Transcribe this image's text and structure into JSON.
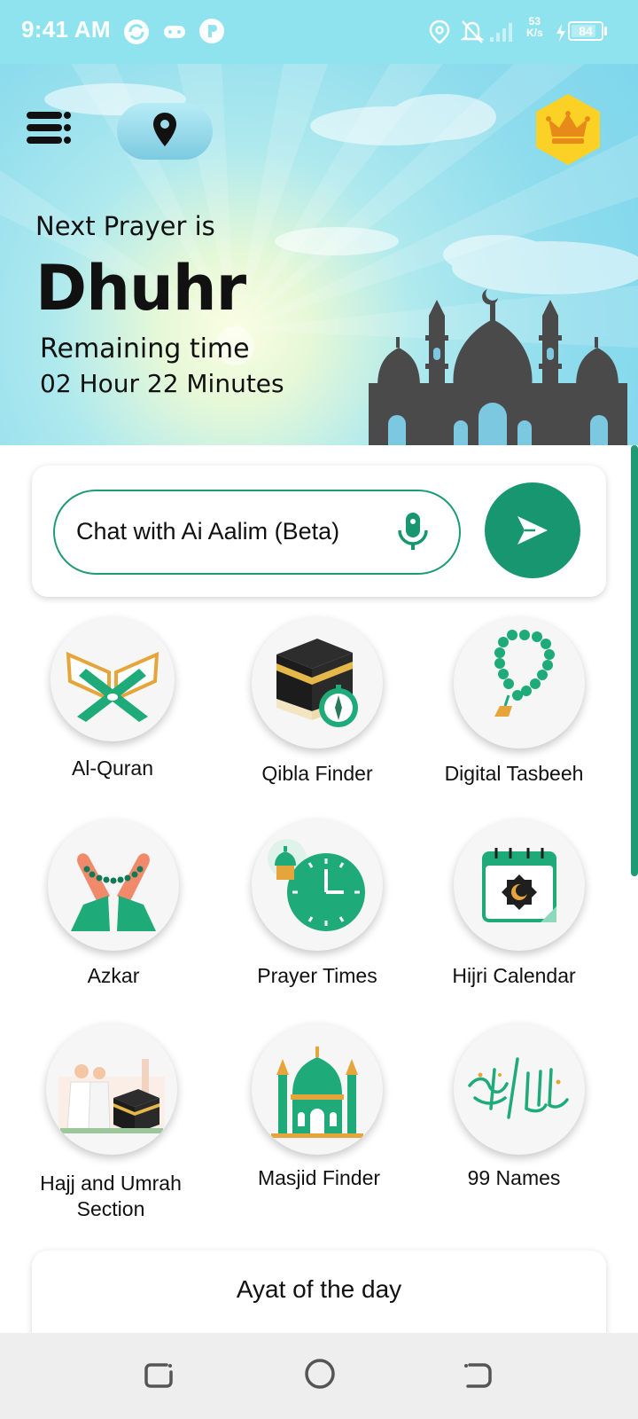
{
  "status_bar": {
    "time": "9:41 AM",
    "network_speed_value": "53",
    "network_speed_unit": "K/s",
    "battery_level": 84,
    "battery_text": "84"
  },
  "hero": {
    "next_prayer_label": "Next Prayer is",
    "prayer_name": "Dhuhr",
    "remaining_label": "Remaining time",
    "remaining_value": "02 Hour 22 Minutes"
  },
  "chat": {
    "placeholder": "Chat with Ai Aalim (Beta)"
  },
  "features": [
    {
      "label": "Al-Quran"
    },
    {
      "label": "Qibla Finder"
    },
    {
      "label": "Digital Tasbeeh"
    },
    {
      "label": "Azkar"
    },
    {
      "label": "Prayer Times"
    },
    {
      "label": "Hijri Calendar"
    },
    {
      "label": "Hajj and Umrah Section"
    },
    {
      "label": "Masjid Finder"
    },
    {
      "label": "99 Names"
    }
  ],
  "ayat": {
    "title": "Ayat of the day"
  },
  "colors": {
    "accent": "#17966f",
    "status_bar": "#8fe3ef",
    "premium": "#fbd126"
  },
  "icons": {
    "menu": "menu-icon",
    "location": "location-pin-icon",
    "premium": "crown-icon",
    "mic": "microphone-icon",
    "send": "send-icon"
  }
}
